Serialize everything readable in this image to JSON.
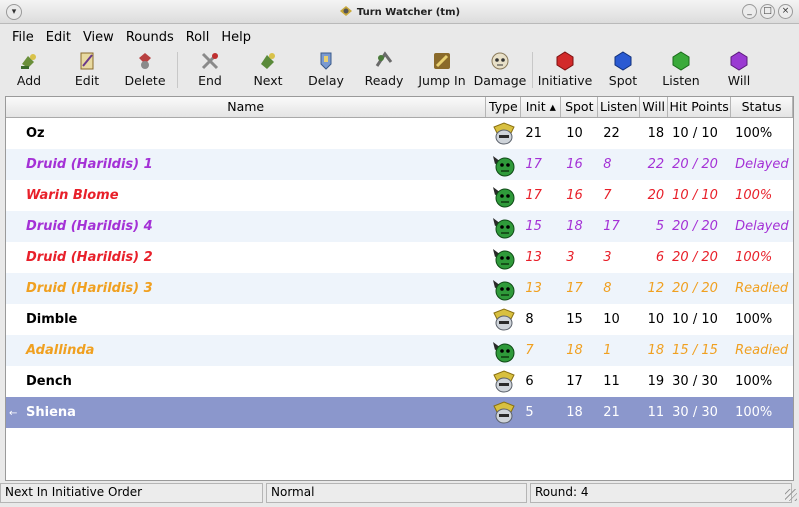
{
  "window": {
    "title": "Turn Watcher (tm)"
  },
  "menu": [
    "File",
    "Edit",
    "View",
    "Rounds",
    "Roll",
    "Help"
  ],
  "toolbar": [
    {
      "label": "Add",
      "icon": "add-icon"
    },
    {
      "label": "Edit",
      "icon": "edit-icon"
    },
    {
      "label": "Delete",
      "icon": "delete-icon"
    },
    {
      "label": "End",
      "icon": "end-icon"
    },
    {
      "label": "Next",
      "icon": "next-icon"
    },
    {
      "label": "Delay",
      "icon": "delay-icon"
    },
    {
      "label": "Ready",
      "icon": "ready-icon"
    },
    {
      "label": "Jump In",
      "icon": "jump-in-icon"
    },
    {
      "label": "Damage",
      "icon": "damage-icon"
    },
    {
      "label": "Initiative",
      "icon": "initiative-die-icon"
    },
    {
      "label": "Spot",
      "icon": "spot-die-icon"
    },
    {
      "label": "Listen",
      "icon": "listen-die-icon"
    },
    {
      "label": "Will",
      "icon": "will-die-icon"
    }
  ],
  "columns": [
    "Name",
    "Type",
    "Init ▴",
    "Spot",
    "Listen",
    "Will",
    "Hit Points",
    "Status"
  ],
  "rows": [
    {
      "name": "Oz",
      "type": "player",
      "init": "21",
      "spot": "10",
      "listen": "22",
      "will": "18",
      "hp": "10 / 10",
      "status": "100%",
      "color": "#000000",
      "style": "normal"
    },
    {
      "name": "Druid (Harildis) 1",
      "type": "monster",
      "init": "17",
      "spot": "16",
      "listen": "8",
      "will": "22",
      "hp": "20 / 20",
      "status": "Delayed",
      "color": "#a431d6",
      "style": "italic"
    },
    {
      "name": "Warin Blome",
      "type": "monster",
      "init": "17",
      "spot": "16",
      "listen": "7",
      "will": "20",
      "hp": "10 / 10",
      "status": "100%",
      "color": "#e8202a",
      "style": "italic"
    },
    {
      "name": "Druid (Harildis) 4",
      "type": "monster",
      "init": "15",
      "spot": "18",
      "listen": "17",
      "will": "5",
      "hp": "20 / 20",
      "status": "Delayed",
      "color": "#a431d6",
      "style": "italic"
    },
    {
      "name": "Druid (Harildis) 2",
      "type": "monster",
      "init": "13",
      "spot": "3",
      "listen": "3",
      "will": "6",
      "hp": "20 / 20",
      "status": "100%",
      "color": "#e8202a",
      "style": "italic"
    },
    {
      "name": "Druid (Harildis) 3",
      "type": "monster",
      "init": "13",
      "spot": "17",
      "listen": "8",
      "will": "12",
      "hp": "20 / 20",
      "status": "Readied",
      "color": "#f0a020",
      "style": "italic"
    },
    {
      "name": "Dimble",
      "type": "player",
      "init": "8",
      "spot": "15",
      "listen": "10",
      "will": "10",
      "hp": "10 / 10",
      "status": "100%",
      "color": "#000000",
      "style": "normal"
    },
    {
      "name": "Adallinda",
      "type": "monster",
      "init": "7",
      "spot": "18",
      "listen": "1",
      "will": "18",
      "hp": "15 / 15",
      "status": "Readied",
      "color": "#f0a020",
      "style": "italic"
    },
    {
      "name": "Dench",
      "type": "player",
      "init": "6",
      "spot": "17",
      "listen": "11",
      "will": "19",
      "hp": "30 / 30",
      "status": "100%",
      "color": "#000000",
      "style": "normal"
    },
    {
      "name": "Shiena",
      "type": "player",
      "init": "5",
      "spot": "18",
      "listen": "21",
      "will": "11",
      "hp": "30 / 30",
      "status": "100%",
      "color": "#ffffff",
      "style": "selected"
    }
  ],
  "statusbar": {
    "left": "Next In Initiative Order",
    "middle": "Normal",
    "right": "Round: 4"
  }
}
